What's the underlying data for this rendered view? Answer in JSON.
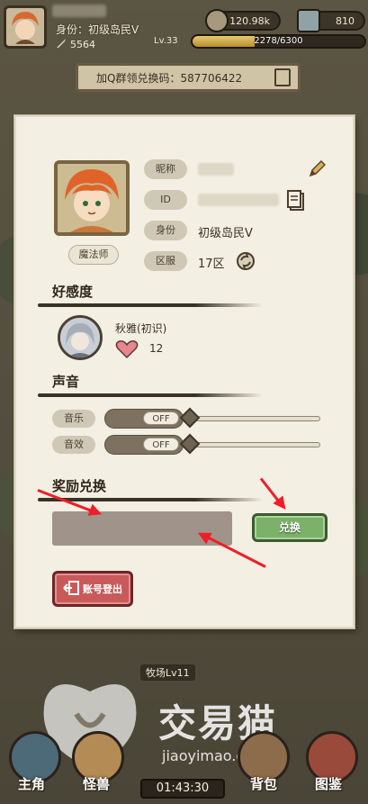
{
  "hud": {
    "identity_text": "身份：初级岛民V",
    "power": "5564",
    "resource_gold": "120.98k",
    "resource_gems": "810",
    "level": "Lv.33",
    "xp_text": "2278/6300",
    "xp_fraction": 0.36,
    "redeem_banner": "加Q群领兑换码：587706422"
  },
  "profile": {
    "class_badge": "魔法师",
    "labels": {
      "nickname": "昵称",
      "id": "ID",
      "identity": "身份",
      "server": "区服"
    },
    "identity_value": "初级岛民V",
    "server_value": "17区"
  },
  "affection": {
    "title": "好感度",
    "companion_name": "秋雅(初识)",
    "hearts": "12"
  },
  "sound": {
    "title": "声音",
    "music_label": "音乐",
    "sfx_label": "音效",
    "music_toggle": "OFF",
    "sfx_toggle": "OFF",
    "music_level": 0,
    "sfx_level": 0
  },
  "redeem": {
    "title": "奖励兑换",
    "button": "兑换",
    "input_value": ""
  },
  "account": {
    "logout": "账号登出"
  },
  "bottom": {
    "ranch": "牧场Lv11",
    "timer": "01:43:30",
    "tabs": [
      "主角",
      "怪兽",
      "背包",
      "图鉴"
    ],
    "watermark": "交易猫",
    "watermark_url": "jiaoyimao.com"
  },
  "colors": {
    "panel": "#f3efe2",
    "green_button": "#7bb168",
    "red_button": "#c95a5a",
    "annotation_arrow": "#f11d28"
  }
}
